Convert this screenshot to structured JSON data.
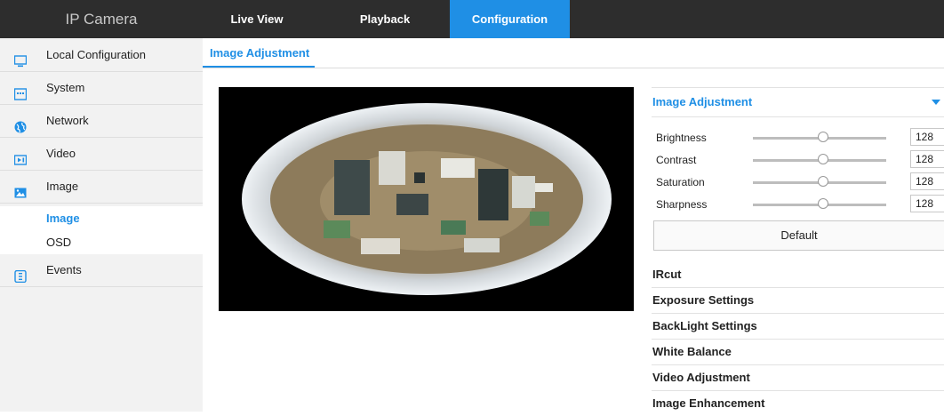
{
  "header": {
    "brand": "IP Camera",
    "tabs": [
      {
        "label": "Live View"
      },
      {
        "label": "Playback"
      },
      {
        "label": "Configuration"
      }
    ],
    "active_tab_color": "#1f8fe5"
  },
  "sidebar": {
    "items": [
      {
        "label": "Local Configuration",
        "icon": "monitor-icon"
      },
      {
        "label": "System",
        "icon": "system-icon"
      },
      {
        "label": "Network",
        "icon": "globe-icon"
      },
      {
        "label": "Video",
        "icon": "video-icon"
      },
      {
        "label": "Image",
        "icon": "image-icon"
      }
    ],
    "sub_items": [
      {
        "label": "Image"
      },
      {
        "label": "OSD"
      }
    ],
    "events": {
      "label": "Events",
      "icon": "events-icon"
    }
  },
  "content": {
    "tab": "Image Adjustment"
  },
  "panel": {
    "title": "Image Adjustment",
    "sliders": [
      {
        "label": "Brightness",
        "value": "128"
      },
      {
        "label": "Contrast",
        "value": "128"
      },
      {
        "label": "Saturation",
        "value": "128"
      },
      {
        "label": "Sharpness",
        "value": "128"
      }
    ],
    "default_label": "Default",
    "sections": [
      "IRcut",
      "Exposure Settings",
      "BackLight Settings",
      "White Balance",
      "Video Adjustment",
      "Image Enhancement"
    ]
  }
}
